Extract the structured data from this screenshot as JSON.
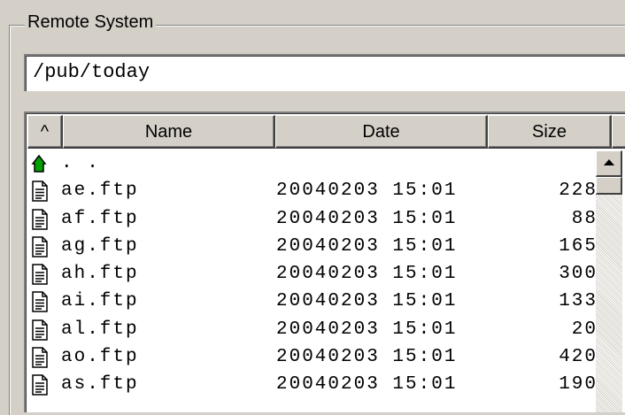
{
  "group": {
    "label": "Remote System"
  },
  "path": {
    "value": "/pub/today"
  },
  "columns": {
    "sort": "^",
    "name": "Name",
    "date": "Date",
    "size": "Size"
  },
  "parent_row": {
    "name": ". .",
    "icon": "parent-folder-up-icon"
  },
  "files": [
    {
      "name": "ae.ftp",
      "date": "20040203 15:01",
      "size": "228",
      "icon": "text-file-icon"
    },
    {
      "name": "af.ftp",
      "date": "20040203 15:01",
      "size": "88",
      "icon": "text-file-icon"
    },
    {
      "name": "ag.ftp",
      "date": "20040203 15:01",
      "size": "165",
      "icon": "text-file-icon"
    },
    {
      "name": "ah.ftp",
      "date": "20040203 15:01",
      "size": "300",
      "icon": "text-file-icon"
    },
    {
      "name": "ai.ftp",
      "date": "20040203 15:01",
      "size": "133",
      "icon": "text-file-icon"
    },
    {
      "name": "al.ftp",
      "date": "20040203 15:01",
      "size": "20",
      "icon": "text-file-icon"
    },
    {
      "name": "ao.ftp",
      "date": "20040203 15:01",
      "size": "420",
      "icon": "text-file-icon"
    },
    {
      "name": "as.ftp",
      "date": "20040203 15:01",
      "size": "190",
      "icon": "text-file-icon"
    }
  ],
  "colors": {
    "face": "#d4d0c8",
    "window": "#ffffff",
    "up_arrow": "#008000"
  }
}
